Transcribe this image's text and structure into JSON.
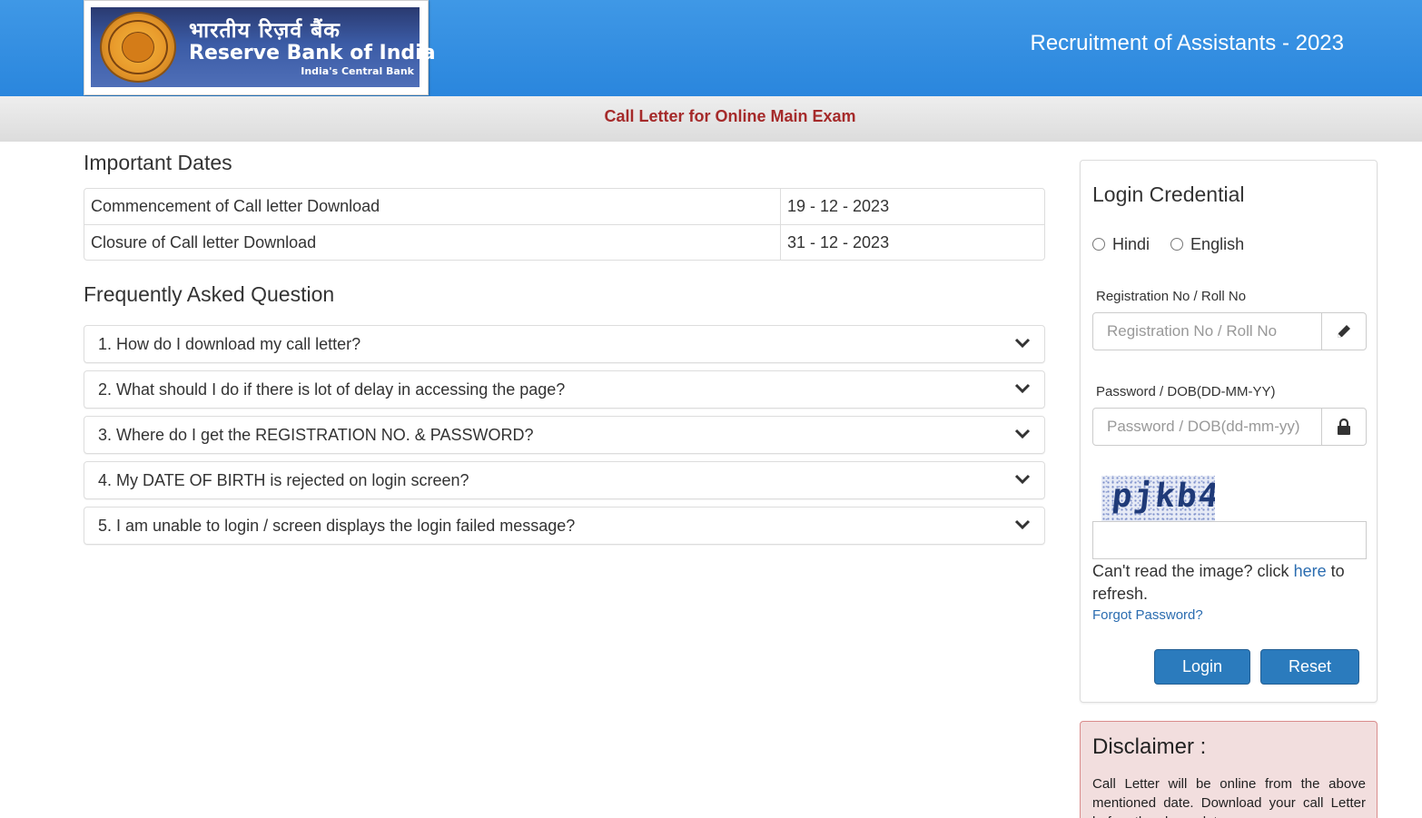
{
  "header": {
    "logo": {
      "hindi": "भारतीय रिज़र्व बैंक",
      "english": "Reserve Bank of India",
      "tagline": "India's Central Bank",
      "seal_icon": "rbi-seal-icon"
    },
    "title": "Recruitment of Assistants - 2023",
    "accent_color": "#2a86dd"
  },
  "subheader": {
    "text": "Call Letter for Online Main Exam",
    "color": "#a52a2a"
  },
  "important_dates": {
    "heading": "Important Dates",
    "rows": [
      {
        "label": "Commencement of Call letter Download",
        "value": "19 - 12 - 2023"
      },
      {
        "label": "Closure of Call letter Download",
        "value": "31 - 12 - 2023"
      }
    ]
  },
  "faq": {
    "heading": "Frequently Asked Question",
    "items": [
      {
        "question": "1. How do I download my call letter?",
        "icon": "chevron-down-icon"
      },
      {
        "question": "2. What should I do if there is lot of delay in accessing the page?",
        "icon": "chevron-down-icon"
      },
      {
        "question": "3. Where do I get the REGISTRATION NO. & PASSWORD?",
        "icon": "chevron-down-icon"
      },
      {
        "question": "4. My DATE OF BIRTH is rejected on login screen?",
        "icon": "chevron-down-icon"
      },
      {
        "question": "5. I am unable to login / screen displays the login failed message?",
        "icon": "chevron-down-icon"
      }
    ]
  },
  "login": {
    "title": "Login Credential",
    "languages": [
      {
        "label": "Hindi",
        "selected": false
      },
      {
        "label": "English",
        "selected": false
      }
    ],
    "registration": {
      "label": "Registration No / Roll No",
      "placeholder": "Registration No / Roll No",
      "value": "",
      "icon": "pencil-icon"
    },
    "password": {
      "label": "Password / DOB(DD-MM-YY)",
      "placeholder": "Password / DOB(dd-mm-yy)",
      "value": "",
      "icon": "lock-icon"
    },
    "captcha_text": "pjkb4",
    "captcha_input_value": "",
    "refresh_text_before": "Can't read the image? click",
    "refresh_link": "here",
    "refresh_text_after": "to refresh.",
    "forgot_password": "Forgot Password?",
    "login_button": "Login",
    "reset_button": "Reset",
    "button_color": "#2b7bbd",
    "link_color": "#2a6cb0"
  },
  "disclaimer": {
    "title": "Disclaimer :",
    "text": "Call Letter will be online from the above mentioned date. Download your call Letter before the above date.",
    "background": "#f2dede"
  }
}
